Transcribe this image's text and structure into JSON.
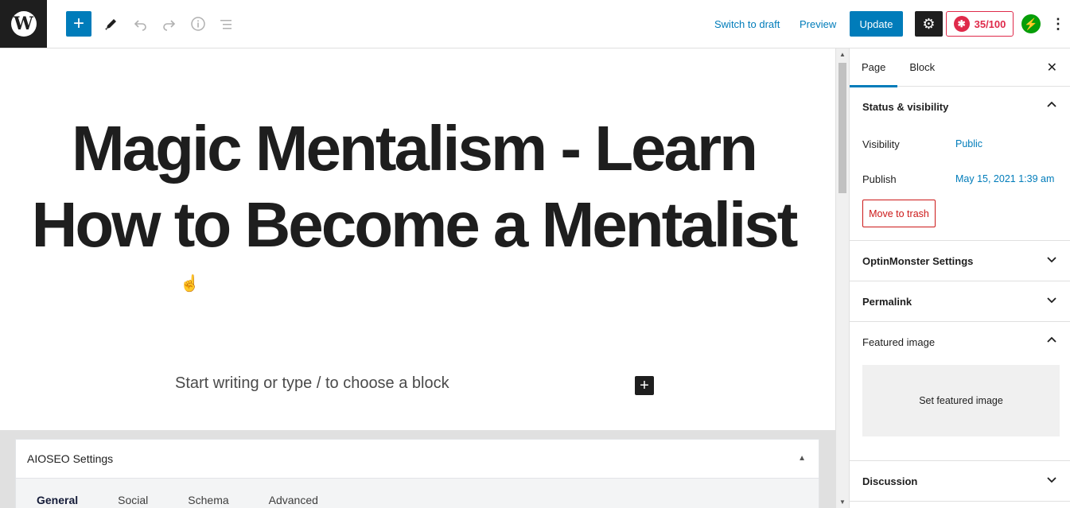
{
  "topbar": {
    "add_block_label": "+",
    "switch_to_draft": "Switch to draft",
    "preview": "Preview",
    "update": "Update",
    "seo_score": "35/100"
  },
  "editor": {
    "title": "Magic Mentalism - Learn How to Become a Mentalist",
    "placeholder": "Start writing or type / to choose a block"
  },
  "aioseo": {
    "heading": "AIOSEO Settings",
    "tabs": [
      "General",
      "Social",
      "Schema",
      "Advanced"
    ]
  },
  "sidebar": {
    "tabs": [
      "Page",
      "Block"
    ],
    "status_visibility": {
      "heading": "Status & visibility",
      "visibility_label": "Visibility",
      "visibility_value": "Public",
      "publish_label": "Publish",
      "publish_value": "May 15, 2021 1:39 am",
      "trash_label": "Move to trash"
    },
    "optinmonster": "OptinMonster Settings",
    "permalink": "Permalink",
    "featured_image": {
      "heading": "Featured image",
      "set_label": "Set featured image"
    },
    "discussion": "Discussion"
  },
  "colors": {
    "accent": "#007cba",
    "danger": "#cc1818",
    "seo_score": "#df2a4a",
    "jetpack": "#069e08"
  }
}
